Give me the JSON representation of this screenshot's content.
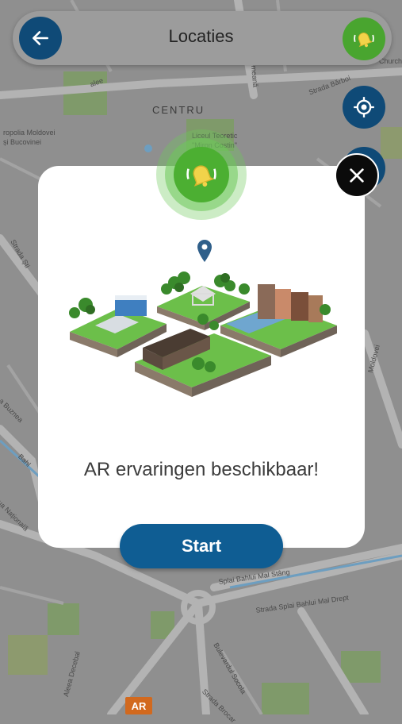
{
  "header": {
    "title": "Locaties"
  },
  "map": {
    "labels": {
      "centru": "CENTRU",
      "mitropolia_1": "ropolia Moldovei",
      "mitropolia_2": "și Bucovinei",
      "barboi": "Strada Bărboi",
      "meana": "meană",
      "church": "Church",
      "alee": "alee",
      "liceul_1": "Liceul Teoretic",
      "liceul_2": "\"Miron Costin\"",
      "strada_st": "Strada Ști",
      "moldovei": "Moldovei",
      "buznea": "a Buznea",
      "bahlui": "Bahl",
      "nationala": "ua Națională",
      "splai_1": "Splai Bahlui Mal Stâng",
      "splai_2": "Strada Splai Bahlui Mal Drept",
      "bulevardul": "Bulevardul Socola",
      "brocar": "Strada Brocar",
      "decebal": "Aleea Decebal"
    },
    "ar_badge": "AR",
    "colors": {
      "background": "#8f8f8f",
      "roads": "#b3b3b3",
      "parks": "#7f9a6a",
      "water": "#6d9ec0"
    }
  },
  "dialog": {
    "message": "AR ervaringen beschikbaar!",
    "start_label": "Start"
  },
  "icons": {
    "back": "arrow-left-icon",
    "bell": "ringing-bell-icon",
    "locate": "crosshair-icon",
    "close": "close-icon",
    "pin": "map-pin-icon"
  },
  "colors": {
    "primary_blue": "#0f4a77",
    "start_blue": "#0f5d93",
    "bell_green": "#4caf32",
    "close_black": "#0b0b0b"
  }
}
